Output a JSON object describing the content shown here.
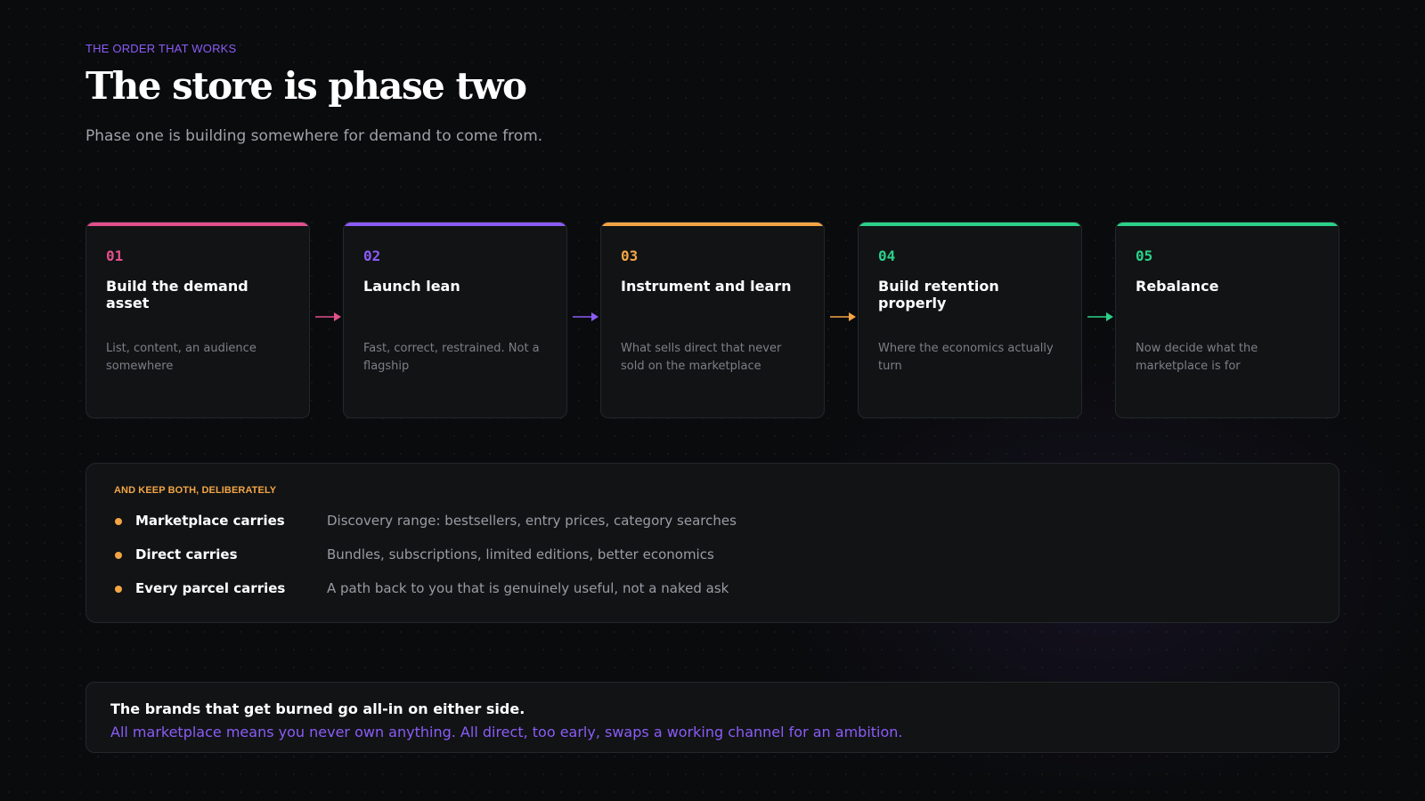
{
  "header": {
    "eyebrow": "THE ORDER THAT WORKS",
    "title": "The store is phase two",
    "subtitle": "Phase one is building somewhere for demand to come from."
  },
  "steps": [
    {
      "number": "01",
      "title": "Build the demand asset",
      "description": "List, content, an audience somewhere",
      "accent": "#e0508c"
    },
    {
      "number": "02",
      "title": "Launch lean",
      "description": "Fast, correct, restrained. Not a flagship",
      "accent": "#8b5cf6"
    },
    {
      "number": "03",
      "title": "Instrument and learn",
      "description": "What sells direct that never sold on the marketplace",
      "accent": "#f3a545"
    },
    {
      "number": "04",
      "title": "Build retention properly",
      "description": "Where the economics actually turn",
      "accent": "#2bd18a"
    },
    {
      "number": "05",
      "title": "Rebalance",
      "description": "Now decide what the marketplace is for",
      "accent": "#2bd18a"
    }
  ],
  "keep": {
    "label": "AND KEEP BOTH, DELIBERATELY",
    "rows": [
      {
        "who": "Marketplace carries",
        "what": "Discovery range: bestsellers, entry prices, category searches"
      },
      {
        "who": "Direct carries",
        "what": "Bundles, subscriptions, limited editions, better economics"
      },
      {
        "who": "Every parcel carries",
        "what": "A path back to you that is genuinely useful, not a naked ask"
      }
    ]
  },
  "callout": {
    "line1": "The brands that get burned go all-in on either side.",
    "line2": "All marketplace means you never own anything. All direct, too early, swaps a working channel for an ambition."
  },
  "colors": {
    "background": "#0a0b0d",
    "card": "#111315",
    "purple": "#8b5cf6",
    "amber": "#f3a545",
    "pink": "#e0508c",
    "green": "#2bd18a"
  }
}
